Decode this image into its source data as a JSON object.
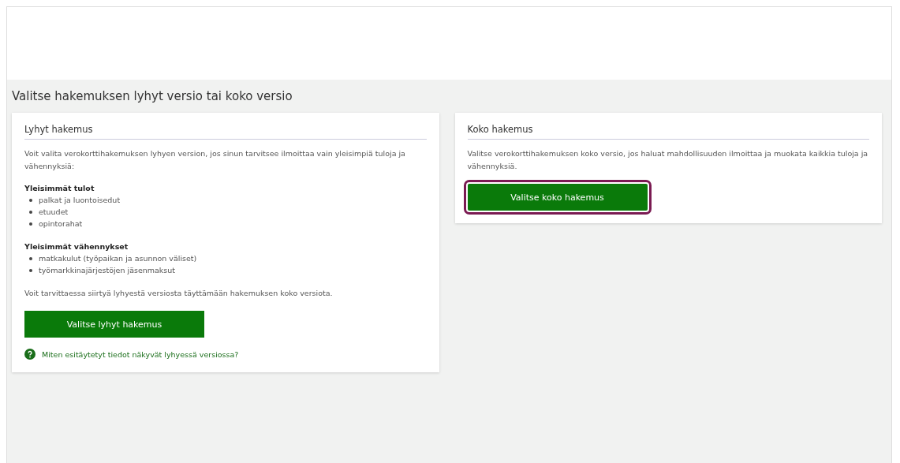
{
  "heading": "Valitse hakemuksen lyhyt versio tai koko versio",
  "cards": [
    {
      "title": "Lyhyt hakemus",
      "intro": "Voit valita verokorttihakemuksen lyhyen version, jos sinun tarvitsee ilmoittaa vain yleisimpiä tuloja ja vähennyksiä:",
      "groups": [
        {
          "title": "Yleisimmät tulot",
          "items": [
            "palkat ja luontoisedut",
            "etuudet",
            "opintorahat"
          ]
        },
        {
          "title": "Yleisimmät vähennykset",
          "items": [
            "matkakulut (työpaikan ja asunnon väliset)",
            "työmarkkinajärjestöjen jäsenmaksut"
          ]
        }
      ],
      "note": "Voit tarvittaessa siirtyä lyhyestä versiosta täyttämään hakemuksen koko versiota.",
      "button": {
        "label": "Valitse lyhyt hakemus",
        "focused": false
      },
      "help_link": "Miten esitäytetyt tiedot näkyvät lyhyessä versiossa?"
    },
    {
      "title": "Koko hakemus",
      "intro": "Valitse verokorttihakemuksen koko versio, jos haluat mahdollisuuden ilmoittaa ja muokata kaikkia tuloja ja vähennyksiä.",
      "button": {
        "label": "Valitse koko hakemus",
        "focused": true
      }
    }
  ]
}
